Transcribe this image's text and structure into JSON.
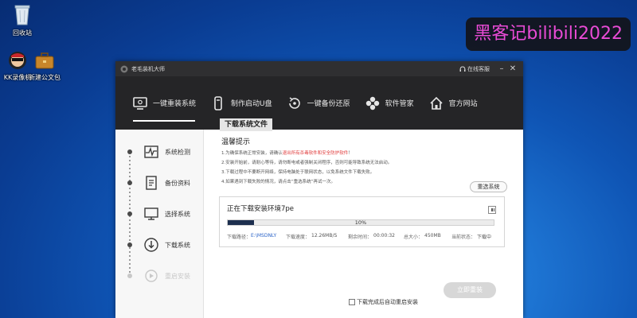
{
  "desktop": {
    "icons": [
      {
        "label": "回收站"
      },
      {
        "label": "KK录像机"
      },
      {
        "label": "新建公文包"
      }
    ],
    "watermark": "黑客记bilibili2022"
  },
  "window": {
    "title": "老毛装机大师",
    "titlebar_link": "在线客服",
    "controls": {
      "minimize": "–",
      "close": "✕"
    },
    "nav": [
      {
        "label": "一键重装系统",
        "icon": "monitor-icon"
      },
      {
        "label": "制作启动U盘",
        "icon": "usb-icon"
      },
      {
        "label": "一键备份还原",
        "icon": "backup-restore-icon"
      },
      {
        "label": "软件管家",
        "icon": "software-icon"
      },
      {
        "label": "官方网站",
        "icon": "home-icon"
      }
    ],
    "active_nav": "一键重装系统",
    "steps": [
      {
        "label": "系统检测",
        "icon": "pulse-icon"
      },
      {
        "label": "备份资料",
        "icon": "document-icon"
      },
      {
        "label": "选择系统",
        "icon": "display-icon"
      },
      {
        "label": "下载系统",
        "icon": "download-icon"
      },
      {
        "label": "重启安装",
        "icon": "restart-icon"
      }
    ],
    "section_title": "下载系统文件",
    "tips_title": "温馨提示",
    "tips": [
      {
        "before": "1.为确保系统正常安装，请确认",
        "highlight": "退出所有杀毒软件和安全防护软件",
        "after": "！"
      },
      {
        "before": "2.安装开始前，请耐心等待，请勿断电或者强制关闭程序，否则可能导致系统无法启动。",
        "highlight": "",
        "after": ""
      },
      {
        "before": "3.下载过程中不要断开网络，保持电脑处于联网状态，以免系统文件下载失败。",
        "highlight": "",
        "after": ""
      },
      {
        "before": "4.如果遇到下载失败的情况，请点击“重选系统”再试一次。",
        "highlight": "",
        "after": ""
      }
    ],
    "reselect_label": "重选系统",
    "progress": {
      "title": "正在下载安装环境7pe",
      "percent_text": "10%",
      "percent": 10,
      "path_label": "下载路径：",
      "path_value": "E:\\MSDNLY",
      "speed_label": "下载速度：",
      "speed_value": "12.26MB/S",
      "time_label": "剩余时间：",
      "time_value": "00:00:32",
      "size_label": "总大小：",
      "size_value": "450MB",
      "state_label": "当前状态：",
      "state_value": "下载中"
    },
    "restart_label": "立即重装",
    "auto_restart_label": "下载完成后自动重启安装"
  }
}
